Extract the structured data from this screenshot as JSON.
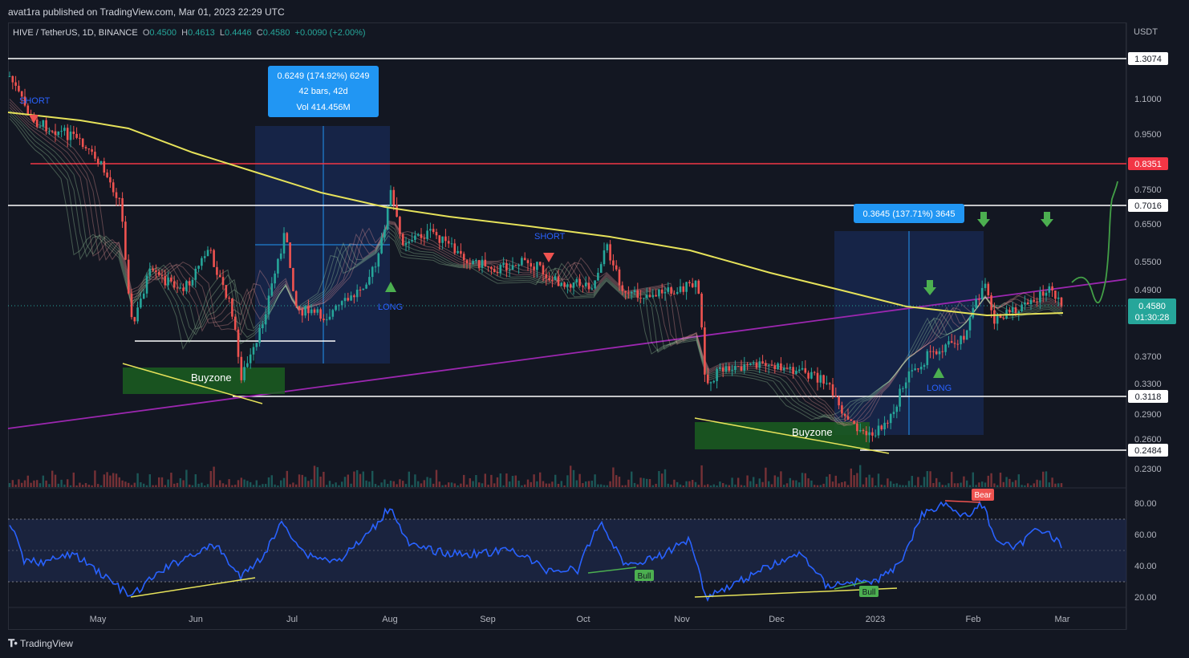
{
  "header": {
    "publisher_line": "avat1ra published on TradingView.com, Mar 01, 2023 22:29 UTC"
  },
  "legend": {
    "symbol": "HIVE / TetherUS, 1D, BINANCE",
    "open_label": "O",
    "open": "0.4500",
    "high_label": "H",
    "high": "0.4613",
    "low_label": "L",
    "low": "0.4446",
    "close_label": "C",
    "close": "0.4580",
    "change": "+0.0090 (+2.00%)"
  },
  "price_axis": {
    "currency": "USDT",
    "ticks": [
      "1.1000",
      "0.9500",
      "0.7500",
      "0.6500",
      "0.5500",
      "0.4900",
      "0.3700",
      "0.3300",
      "0.2900",
      "0.2600",
      "0.2300"
    ],
    "level_tags": [
      {
        "label": "1.3074",
        "color": "#ffffff",
        "text_color": "#131722"
      },
      {
        "label": "0.8351",
        "color": "#f23645",
        "text_color": "#ffffff"
      },
      {
        "label": "0.7016",
        "color": "#ffffff",
        "text_color": "#131722"
      },
      {
        "label": "0.3118",
        "color": "#ffffff",
        "text_color": "#131722"
      },
      {
        "label": "0.2484",
        "color": "#ffffff",
        "text_color": "#131722"
      }
    ],
    "last_price": "0.4580",
    "countdown": "01:30:28",
    "last_price_color": "#26a69a"
  },
  "rsi_axis": {
    "ticks": [
      "80.00",
      "60.00",
      "40.00",
      "20.00"
    ]
  },
  "time_axis": {
    "labels": [
      "May",
      "Jun",
      "Jul",
      "Aug",
      "Sep",
      "Oct",
      "Nov",
      "Dec",
      "2023",
      "Feb",
      "Mar"
    ]
  },
  "annotations": {
    "range_box_1": {
      "line1": "0.6249 (174.92%) 6249",
      "line2": "42 bars, 42d",
      "line3": "Vol 414.456M"
    },
    "range_box_2": {
      "line1": "0.3645 (137.71%) 3645"
    },
    "short_1": "SHORT",
    "short_2": "SHORT",
    "long_1": "LONG",
    "long_2": "LONG",
    "buyzone_1": "Buyzone",
    "buyzone_2": "Buyzone",
    "bull_1": "Bull",
    "bull_2": "Bull",
    "bear_1": "Bear"
  },
  "colors": {
    "background": "#131722",
    "up": "#26a69a",
    "down": "#ef5350",
    "ma": "#e6e25a",
    "trend": "#9c27b0",
    "resistance": "#f23645",
    "rsi": "#2962ff",
    "buyzone": "#1b5e20"
  },
  "footer": {
    "brand": "TradingView"
  }
}
